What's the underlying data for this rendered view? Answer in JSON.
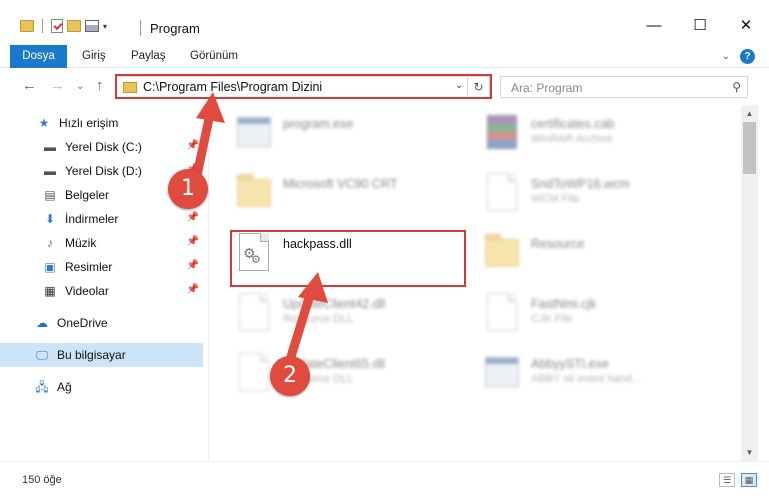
{
  "window": {
    "title": "Program",
    "controls": {
      "minimize": "—",
      "maximize": "☐",
      "close": "✕"
    }
  },
  "ribbon": {
    "tabs": [
      "Dosya",
      "Giriş",
      "Paylaş",
      "Görünüm"
    ],
    "help": "?"
  },
  "address": {
    "path": "C:\\Program Files\\Program Dizini",
    "dropdown": "⌄",
    "refresh": "↻"
  },
  "nav": {
    "back": "←",
    "forward": "→",
    "recent": "⌄",
    "up": "↑"
  },
  "search": {
    "placeholder": "Ara: Program",
    "icon": "search-icon"
  },
  "sidebar": {
    "items": [
      {
        "label": "Hızlı erişim",
        "icon": "star-icon"
      },
      {
        "label": "Yerel Disk (C:)",
        "icon": "drive-icon",
        "pinned": true
      },
      {
        "label": "Yerel Disk (D:)",
        "icon": "drive-icon",
        "pinned": true
      },
      {
        "label": "Belgeler",
        "icon": "documents-icon",
        "pinned": true
      },
      {
        "label": "İndirmeler",
        "icon": "download-icon",
        "pinned": true
      },
      {
        "label": "Müzik",
        "icon": "music-icon",
        "pinned": true
      },
      {
        "label": "Resimler",
        "icon": "pictures-icon",
        "pinned": true
      },
      {
        "label": "Videolar",
        "icon": "videos-icon",
        "pinned": true
      },
      {
        "label": "OneDrive",
        "icon": "cloud-icon"
      },
      {
        "label": "Bu bilgisayar",
        "icon": "computer-icon",
        "selected": true
      },
      {
        "label": "Ağ",
        "icon": "network-icon"
      }
    ]
  },
  "files": [
    {
      "name": "program.exe",
      "type": "",
      "icon": "exe-icon",
      "faded": true
    },
    {
      "name": "certificates.cab",
      "type": "WinRAR Archive",
      "icon": "rar-icon",
      "faded": true
    },
    {
      "name": "Microsoft VC90 CRT",
      "type": "",
      "icon": "folder-icon",
      "faded": true
    },
    {
      "name": "SndToWP16.wcm",
      "type": "WCM File",
      "icon": "file-icon",
      "faded": true
    },
    {
      "name": "hackpass.dll",
      "type": "",
      "icon": "dll-icon",
      "faded": false
    },
    {
      "name": "Resource",
      "type": "",
      "icon": "folder-icon",
      "faded": true
    },
    {
      "name": "UpdateClient42.dll",
      "type": "Resource DLL",
      "icon": "dll-icon",
      "faded": true
    },
    {
      "name": "FastNmi.cjk",
      "type": "CJK File",
      "icon": "file-icon",
      "faded": true
    },
    {
      "name": "UpdateClient65.dll",
      "type": "Resource DLL",
      "icon": "dll-icon",
      "faded": true
    },
    {
      "name": "AbbyySTI.exe",
      "type": "ABBY sti event hand...",
      "icon": "exe-icon",
      "faded": true
    }
  ],
  "annotations": {
    "step1": "1",
    "step2": "2",
    "color": "#e04a3f"
  },
  "status": {
    "count": "150 öğe"
  }
}
